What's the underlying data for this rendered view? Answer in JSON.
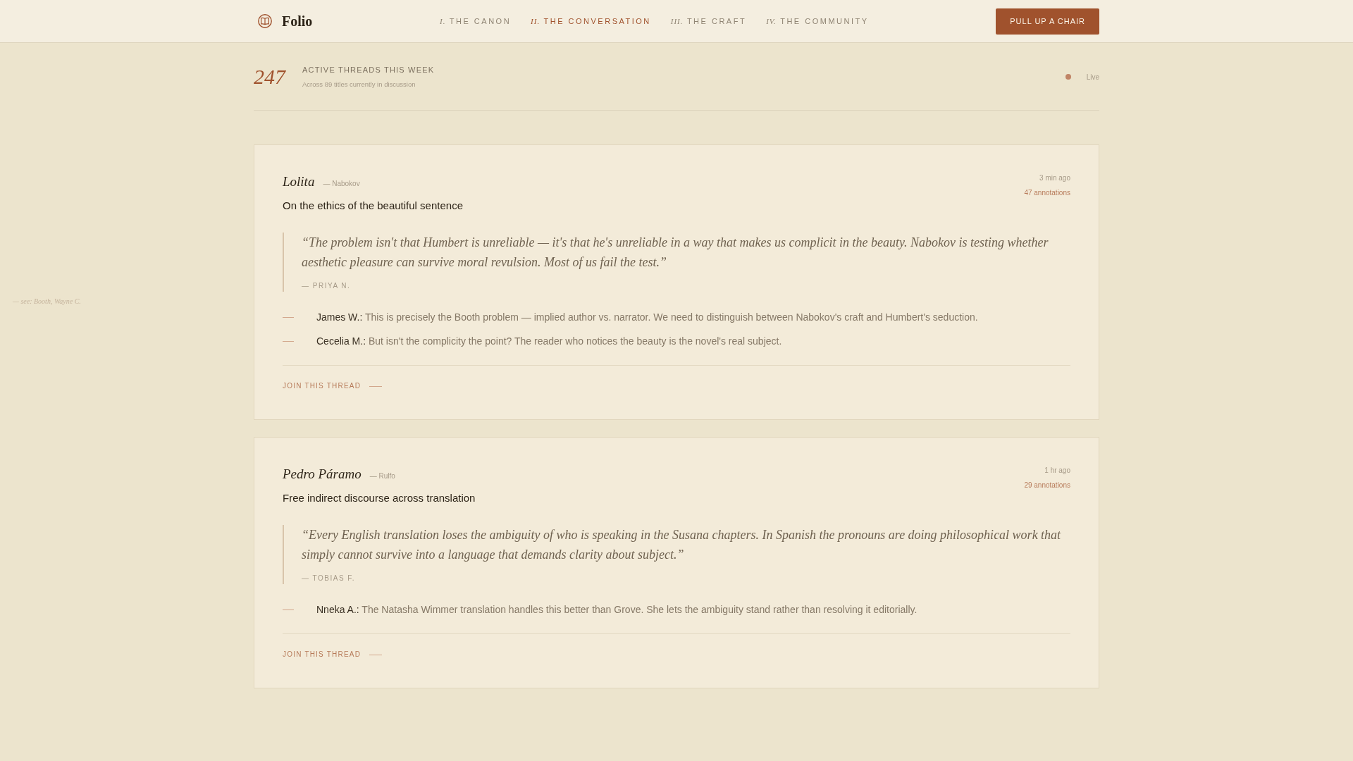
{
  "header": {
    "brand": "Folio",
    "nav": [
      {
        "numeral": "I.",
        "label": "THE CANON",
        "selected": false
      },
      {
        "numeral": "II.",
        "label": "THE CONVERSATION",
        "selected": true
      },
      {
        "numeral": "III.",
        "label": "THE CRAFT",
        "selected": false
      },
      {
        "numeral": "IV.",
        "label": "THE COMMUNITY",
        "selected": false
      }
    ],
    "cta": "PULL UP A CHAIR"
  },
  "stats": {
    "count": "247",
    "label": "ACTIVE THREADS THIS WEEK",
    "detail": "Across 89 titles currently in discussion",
    "status": "Live"
  },
  "margin_note": "— see: Booth, Wayne C.",
  "threads": [
    {
      "book": "Lolita",
      "author": "— Nabokov",
      "topic": "On the ethics of the beautiful sentence",
      "time": "3 min ago",
      "annotations": "47 annotations",
      "quote": "“The problem isn't that Humbert is unreliable — it's that he's unreliable in a way that makes us complicit in the beauty. Nabokov is testing whether aesthetic pleasure can survive moral revulsion. Most of us fail the test.”",
      "quote_author": "— PRIYA N.",
      "replies": [
        {
          "name": "James W.:",
          "text": "This is precisely the Booth problem — implied author vs. narrator. We need to distinguish between Nabokov's craft and Humbert's seduction."
        },
        {
          "name": "Cecelia M.:",
          "text": "But isn't the complicity the point? The reader who notices the beauty is the novel's real subject."
        }
      ],
      "cta": "JOIN THIS THREAD"
    },
    {
      "book": "Pedro Páramo",
      "author": "— Rulfo",
      "topic": "Free indirect discourse across translation",
      "time": "1 hr ago",
      "annotations": "29 annotations",
      "quote": "“Every English translation loses the ambiguity of who is speaking in the Susana chapters. In Spanish the pronouns are doing philosophical work that simply cannot survive into a language that demands clarity about subject.”",
      "quote_author": "— TOBIAS F.",
      "replies": [
        {
          "name": "Nneka A.:",
          "text": "The Natasha Wimmer translation handles this better than Grove. She lets the ambiguity stand rather than resolving it editorially."
        }
      ],
      "cta": "JOIN THIS THREAD"
    }
  ]
}
